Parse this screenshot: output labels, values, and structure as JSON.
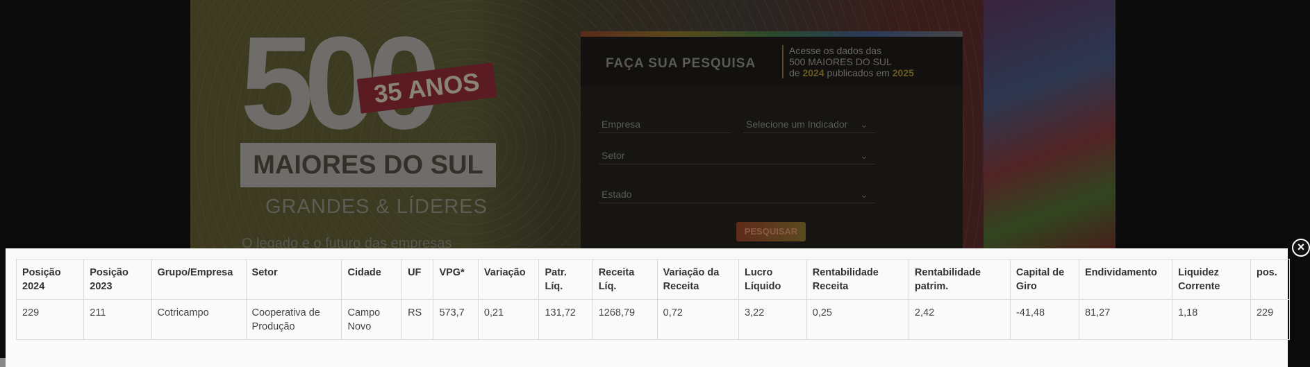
{
  "background": {
    "logo_number": "500",
    "logo_ribbon": "35 ANOS",
    "logo_bar": "MAIORES DO SUL",
    "logo_subtitle": "GRANDES & LÍDERES",
    "logo_tagline": "O legado e o futuro das empresas",
    "search": {
      "title": "FAÇA SUA PESQUISA",
      "info_line1": "Acesse os dados das",
      "info_line2": "500 MAIORES DO SUL",
      "info_line3_pre": "de ",
      "info_year1": "2024",
      "info_line3_mid": " publicados em ",
      "info_year2": "2025",
      "empresa_placeholder": "Empresa",
      "indicador_label": "Selecione um Indicador",
      "setor_label": "Setor",
      "estado_label": "Estado",
      "button_label": "PESQUISAR"
    }
  },
  "modal": {
    "close_label": "×",
    "headers": [
      {
        "l1": "Posição",
        "l2": "2024"
      },
      {
        "l1": "Posição",
        "l2": "2023"
      },
      {
        "l1": "Grupo/Empresa",
        "l2": ""
      },
      {
        "l1": "Setor",
        "l2": ""
      },
      {
        "l1": "Cidade",
        "l2": ""
      },
      {
        "l1": "UF",
        "l2": ""
      },
      {
        "l1": "VPG*",
        "l2": ""
      },
      {
        "l1": "Variação",
        "l2": ""
      },
      {
        "l1": "Patr.",
        "l2": "Líq."
      },
      {
        "l1": "Receita",
        "l2": "Líq."
      },
      {
        "l1": "Variação da",
        "l2": "Receita"
      },
      {
        "l1": "Lucro",
        "l2": "Líquido"
      },
      {
        "l1": "Rentabilidade",
        "l2": "Receita"
      },
      {
        "l1": "Rentabilidade",
        "l2": "patrim."
      },
      {
        "l1": "Capital de",
        "l2": "Giro"
      },
      {
        "l1": "Endividamento",
        "l2": ""
      },
      {
        "l1": "Liquidez",
        "l2": "Corrente"
      },
      {
        "l1": "pos.",
        "l2": ""
      }
    ],
    "row": [
      {
        "l1": "229",
        "l2": ""
      },
      {
        "l1": "211",
        "l2": ""
      },
      {
        "l1": "Cotricampo",
        "l2": ""
      },
      {
        "l1": "Cooperativa de",
        "l2": "Produção"
      },
      {
        "l1": "Campo",
        "l2": "Novo"
      },
      {
        "l1": "RS",
        "l2": ""
      },
      {
        "l1": "573,7",
        "l2": ""
      },
      {
        "l1": "0,21",
        "l2": ""
      },
      {
        "l1": "131,72",
        "l2": ""
      },
      {
        "l1": "1268,79",
        "l2": ""
      },
      {
        "l1": "0,72",
        "l2": ""
      },
      {
        "l1": "3,22",
        "l2": ""
      },
      {
        "l1": "0,25",
        "l2": ""
      },
      {
        "l1": "2,42",
        "l2": ""
      },
      {
        "l1": "-41,48",
        "l2": ""
      },
      {
        "l1": "81,27",
        "l2": ""
      },
      {
        "l1": "1,18",
        "l2": ""
      },
      {
        "l1": "229",
        "l2": ""
      }
    ]
  }
}
